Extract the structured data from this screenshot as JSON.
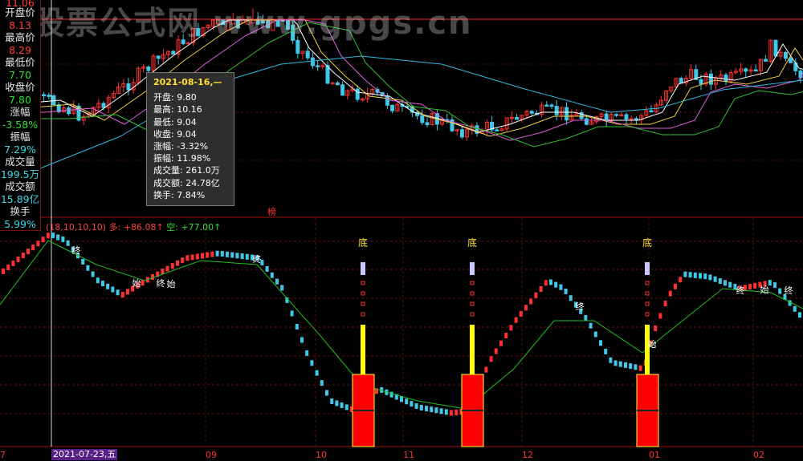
{
  "watermark": "股票公式网 www.gpgs.cn",
  "side_panel": {
    "items": [
      {
        "label": "开盘价",
        "value": "8.13",
        "color": "red"
      },
      {
        "label": "最高价",
        "value": "8.29",
        "color": "red"
      },
      {
        "label": "最低价",
        "value": "7.70",
        "color": "green"
      },
      {
        "label": "收盘价",
        "value": "7.80",
        "color": "green"
      },
      {
        "label": "涨幅",
        "value": "-3.58%",
        "color": "green"
      },
      {
        "label": "振幅",
        "value": "7.29%",
        "color": "cyan"
      },
      {
        "label": "成交量",
        "value": "199.5万",
        "color": "cyan"
      },
      {
        "label": "成交额",
        "value": "15.89亿",
        "color": "cyan"
      },
      {
        "label": "换手",
        "value": "5.99%",
        "color": "cyan"
      }
    ],
    "top_partial": "11.06"
  },
  "tooltip": {
    "date": "2021-08-16,—",
    "rows": [
      {
        "label": "开盘: ",
        "value": "9.80"
      },
      {
        "label": "最高: ",
        "value": "10.16"
      },
      {
        "label": "最低: ",
        "value": "9.04"
      },
      {
        "label": "收盘: ",
        "value": "9.04"
      },
      {
        "label": "涨幅: ",
        "value": "-3.32%"
      },
      {
        "label": "振幅: ",
        "value": "11.98%"
      },
      {
        "label": "成交量: ",
        "value": "261.0万"
      },
      {
        "label": "成交额: ",
        "value": "24.78亿"
      },
      {
        "label": "换手: ",
        "value": "7.84%"
      }
    ]
  },
  "indicator_header": {
    "params": "(18,10,10,10)",
    "bull_label": "多: ",
    "bull_value": "+86.08",
    "bear_label": "空: ",
    "bear_value": "+77.00",
    "arrow": "↑"
  },
  "bang_label": "榜",
  "signals": {
    "bottom_label": "底",
    "start_label": "始",
    "end_label": "终"
  },
  "x_axis": {
    "selected_date": "2021-07-23,五",
    "labels": [
      "7",
      "09",
      "10",
      "11",
      "12",
      "01",
      "02"
    ]
  },
  "colors": {
    "up": "#ff3030",
    "down": "#40c8e8",
    "ma_white": "#ffffff",
    "ma_yellow": "#f0d040",
    "ma_magenta": "#e060e0",
    "ma_green": "#30c030",
    "ma_cyan": "#30b8e0",
    "indicator_line": "#20c020",
    "signal_bar": "#ffff00",
    "signal_box": "#ff0000",
    "signal_top": "#c8c8ff"
  }
}
